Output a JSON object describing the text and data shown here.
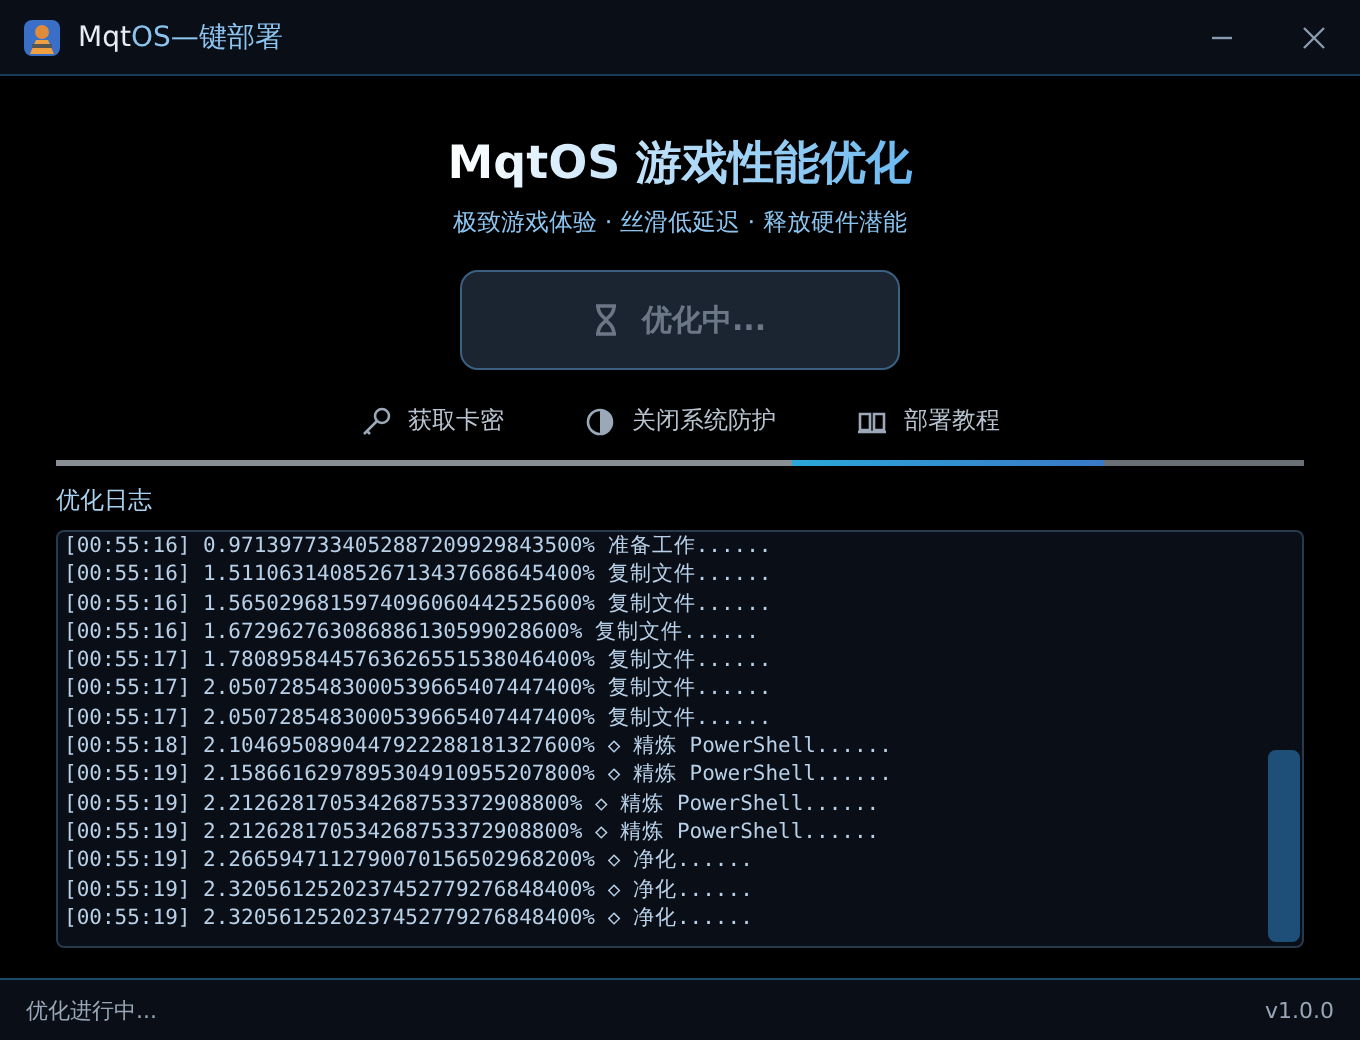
{
  "window": {
    "title_part1": "Mqt",
    "title_part2": "OS—键部署"
  },
  "header": {
    "title": "MqtOS 游戏性能优化",
    "subtitle": "极致游戏体验 · 丝滑低延迟 · 释放硬件潜能"
  },
  "main_button": {
    "label": "优化中...",
    "disabled": true
  },
  "links": [
    {
      "kind": "key",
      "label": "获取卡密"
    },
    {
      "kind": "shield",
      "label": "关闭系统防护"
    },
    {
      "kind": "book",
      "label": "部署教程"
    }
  ],
  "progress": {
    "level": 0.84
  },
  "log": {
    "title": "优化日志",
    "lines": [
      "[00:55:16] 0.9713977334052887209929843500% 准备工作......",
      "[00:55:16] 1.5110631408526713437668645400% 复制文件......",
      "[00:55:16] 1.5650296815974096060442525600% 复制文件......",
      "[00:55:16] 1.672962763086886130599028600% 复制文件......",
      "[00:55:17] 1.7808958445763626551538046400% 复制文件......",
      "[00:55:17] 2.0507285483000539665407447400% 复制文件......",
      "[00:55:17] 2.0507285483000539665407447400% 复制文件......",
      "[00:55:18] 2.1046950890447922288181327600% ◇ 精炼 PowerShell......",
      "[00:55:19] 2.1586616297895304910955207800% ◇ 精炼 PowerShell......",
      "[00:55:19] 2.212628170534268753372908800% ◇ 精炼 PowerShell......",
      "[00:55:19] 2.212628170534268753372908800% ◇ 精炼 PowerShell......",
      "[00:55:19] 2.2665947112790070156502968200% ◇ 净化......",
      "[00:55:19] 2.3205612520237452779276848400% ◇ 净化......",
      "[00:55:19] 2.3205612520237452779276848400% ◇ 净化......"
    ]
  },
  "status_bar": {
    "status": "优化进行中...",
    "version": "v1.0.0"
  }
}
